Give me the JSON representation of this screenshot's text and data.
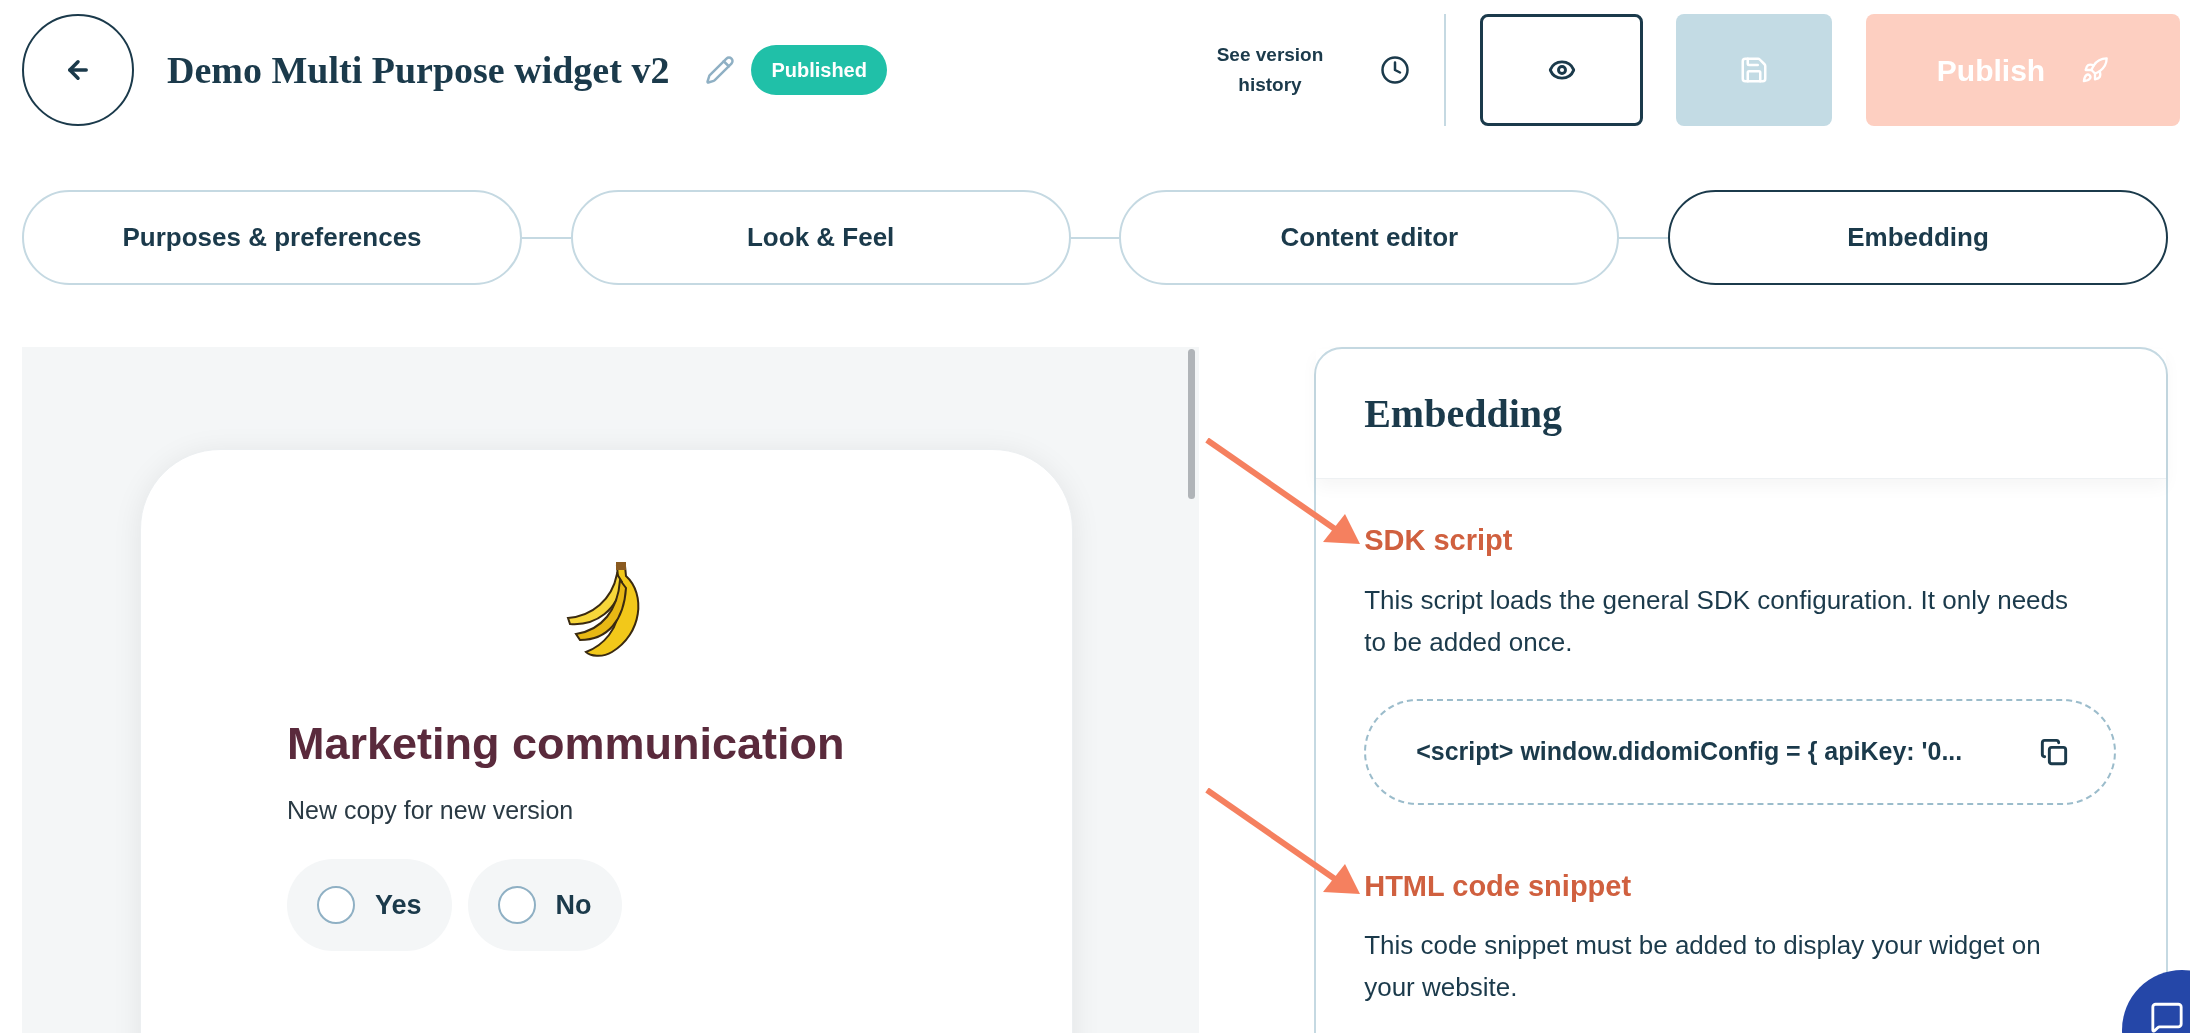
{
  "header": {
    "title": "Demo Multi Purpose widget v2",
    "status": "Published",
    "version_history": "See version history",
    "publish": {
      "label": "Publish",
      "disabled": true
    },
    "save": {
      "disabled": true
    }
  },
  "steps": [
    {
      "label": "Purposes & preferences",
      "selected": false
    },
    {
      "label": "Look & Feel",
      "selected": false
    },
    {
      "label": "Content editor",
      "selected": false
    },
    {
      "label": "Embedding",
      "selected": true
    }
  ],
  "preview": {
    "heading": "Marketing communication",
    "description": "New copy for new version",
    "options": [
      {
        "label": "Yes",
        "selected": false
      },
      {
        "label": "No",
        "selected": false
      }
    ]
  },
  "embedding": {
    "title": "Embedding",
    "sections": [
      {
        "title": "SDK script",
        "description": "This script loads the general SDK configuration. It only needs to be added once.",
        "code": "<script> window.didomiConfig = { apiKey: '0..."
      },
      {
        "title": "HTML code snippet",
        "description": "This code snippet must be added to display your widget on your website."
      }
    ]
  }
}
